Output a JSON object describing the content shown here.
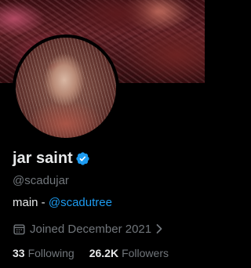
{
  "profile": {
    "display_name": "jar saint",
    "handle": "@scadujar",
    "bio_text": "main - ",
    "bio_link": "@scadutree",
    "joined": "Joined December 2021",
    "verified": true
  },
  "stats": {
    "following_count": "33",
    "following_label": "Following",
    "followers_count": "26.2K",
    "followers_label": "Followers"
  },
  "colors": {
    "background": "#000000",
    "primary_text": "#e7e9ea",
    "secondary_text": "#71767b",
    "accent": "#1d9bf0"
  },
  "icons": {
    "verified": "verified-badge-icon",
    "calendar": "calendar-icon",
    "chevron": "chevron-right-icon"
  }
}
